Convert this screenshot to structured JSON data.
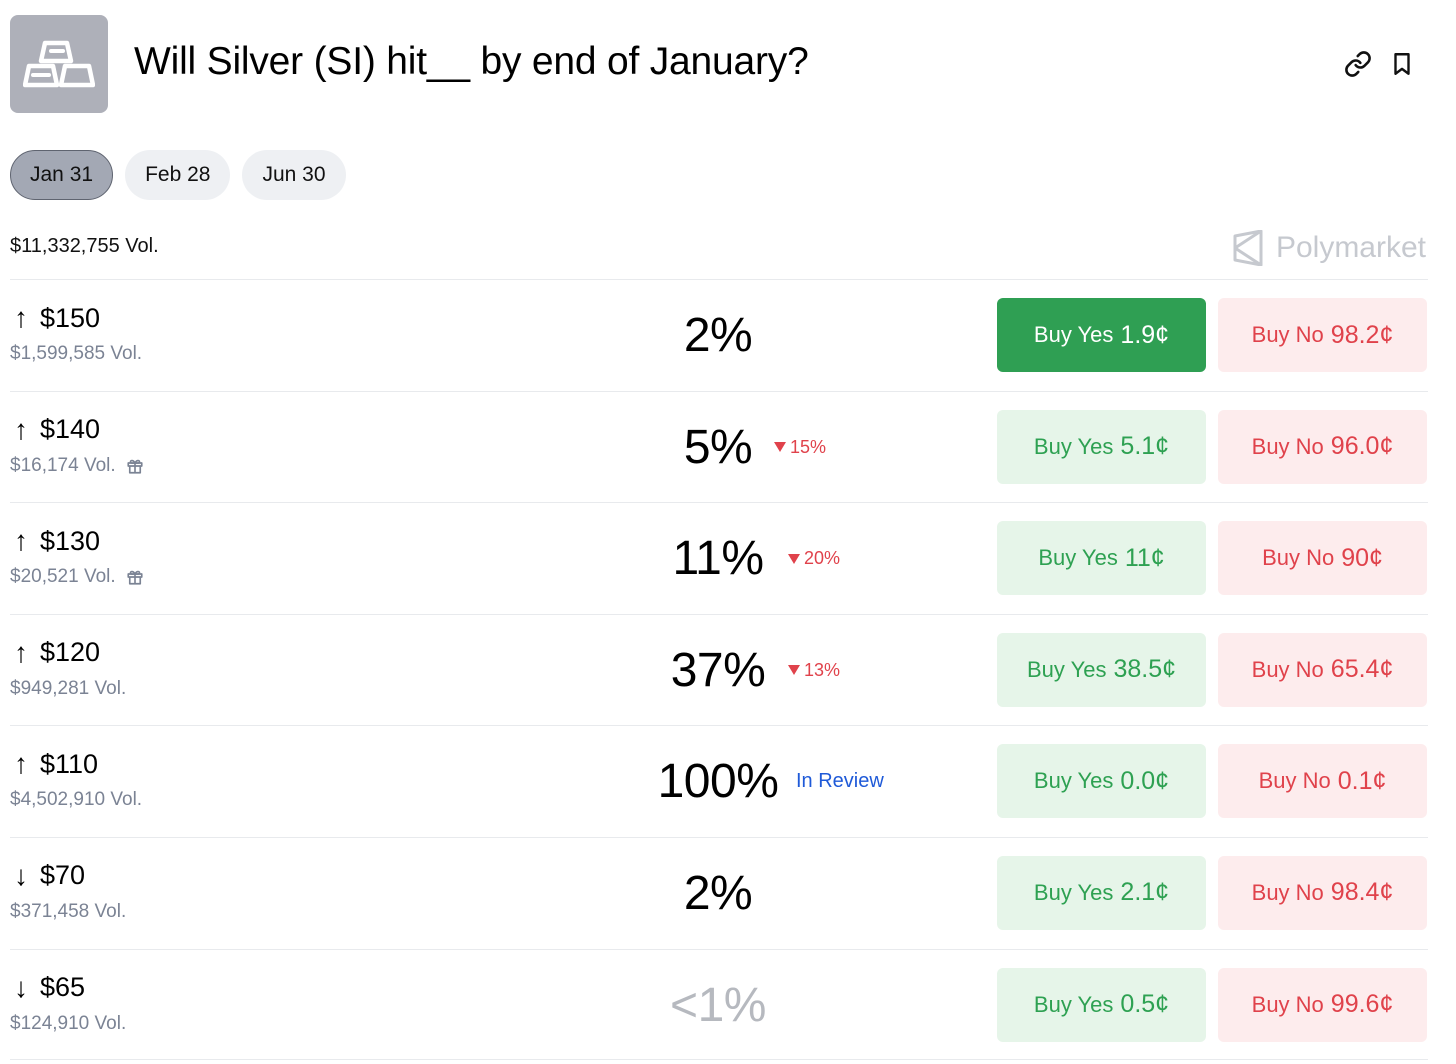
{
  "header": {
    "title": "Will Silver (SI) hit__ by end of January?",
    "icon": "silver-bars-icon",
    "actions": [
      "link-icon",
      "bookmark-icon"
    ]
  },
  "tabs": [
    {
      "label": "Jan 31",
      "active": true
    },
    {
      "label": "Feb 28",
      "active": false
    },
    {
      "label": "Jun 30",
      "active": false
    }
  ],
  "total_volume": "$11,332,755 Vol.",
  "brand": "Polymarket",
  "colors": {
    "yes": "#2ea152",
    "yes_bg": "#e6f5e9",
    "no": "#e0424b",
    "no_bg": "#fdeced",
    "review": "#1f5ad8"
  },
  "rows": [
    {
      "arrow": "↑",
      "price": "$150",
      "vol": "$1,599,585 Vol.",
      "gift": false,
      "pct": "2%",
      "change": "",
      "status": "",
      "yes_label": "Buy Yes",
      "yes_price": "1.9¢",
      "no_label": "Buy No",
      "no_price": "98.2¢"
    },
    {
      "arrow": "↑",
      "price": "$140",
      "vol": "$16,174 Vol.",
      "gift": true,
      "pct": "5%",
      "change": "15%",
      "status": "",
      "yes_label": "Buy Yes",
      "yes_price": "5.1¢",
      "no_label": "Buy No",
      "no_price": "96.0¢"
    },
    {
      "arrow": "↑",
      "price": "$130",
      "vol": "$20,521 Vol.",
      "gift": true,
      "pct": "11%",
      "change": "20%",
      "status": "",
      "yes_label": "Buy Yes",
      "yes_price": "11¢",
      "no_label": "Buy No",
      "no_price": "90¢"
    },
    {
      "arrow": "↑",
      "price": "$120",
      "vol": "$949,281 Vol.",
      "gift": false,
      "pct": "37%",
      "change": "13%",
      "status": "",
      "yes_label": "Buy Yes",
      "yes_price": "38.5¢",
      "no_label": "Buy No",
      "no_price": "65.4¢"
    },
    {
      "arrow": "↑",
      "price": "$110",
      "vol": "$4,502,910 Vol.",
      "gift": false,
      "pct": "100%",
      "change": "",
      "status": "In Review",
      "yes_label": "Buy Yes",
      "yes_price": "0.0¢",
      "no_label": "Buy No",
      "no_price": "0.1¢"
    },
    {
      "arrow": "↓",
      "price": "$70",
      "vol": "$371,458 Vol.",
      "gift": false,
      "pct": "2%",
      "change": "",
      "status": "",
      "yes_label": "Buy Yes",
      "yes_price": "2.1¢",
      "no_label": "Buy No",
      "no_price": "98.4¢"
    },
    {
      "arrow": "↓",
      "price": "$65",
      "vol": "$124,910 Vol.",
      "gift": false,
      "pct": "<1%",
      "change": "",
      "status": "",
      "yes_label": "Buy Yes",
      "yes_price": "0.5¢",
      "no_label": "Buy No",
      "no_price": "99.6¢"
    }
  ]
}
